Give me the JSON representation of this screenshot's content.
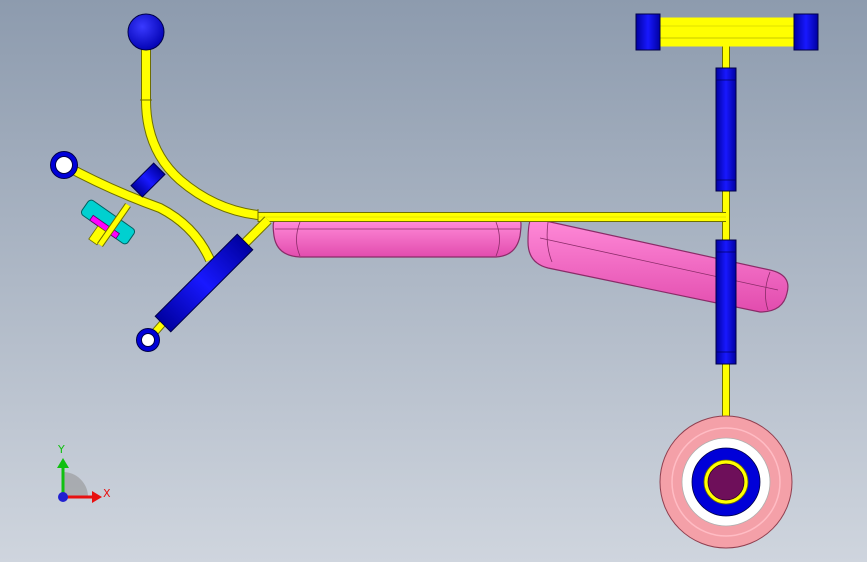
{
  "viewport": {
    "background_top": "#8d9bae",
    "background_bottom": "#cfd5de"
  },
  "colors": {
    "frame": "#ffff00",
    "frame_edge": "#6e6e00",
    "cylinder": "#0000d8",
    "cylinder_edge": "#000048",
    "seat": "#ff66c8",
    "seat_edge": "#8a2c68",
    "disc": "#00d0d0",
    "disc_accent": "#ff00ff",
    "wheel_tire": "#f4a0a8",
    "wheel_rim": "#ffffff",
    "wheel_hub": "#0000d8",
    "wheel_core": "#6e0f5a"
  },
  "model": {
    "parts": [
      {
        "name": "handle-knob",
        "icon": "ball"
      },
      {
        "name": "bent-lever-tube",
        "icon": "tube"
      },
      {
        "name": "main-frame-tube",
        "icon": "tube"
      },
      {
        "name": "link-arm",
        "icon": "tube"
      },
      {
        "name": "damper-cylinder",
        "icon": "cylinder"
      },
      {
        "name": "small-cylinder",
        "icon": "cylinder"
      },
      {
        "name": "rear-disc",
        "icon": "disc"
      },
      {
        "name": "front-seat-pad",
        "icon": "pad"
      },
      {
        "name": "rear-seat-pad",
        "icon": "pad"
      },
      {
        "name": "t-handlebar",
        "icon": "bar"
      },
      {
        "name": "steering-column",
        "icon": "tube"
      },
      {
        "name": "front-wheel",
        "icon": "wheel"
      }
    ]
  },
  "triad": {
    "x_label": "X",
    "y_label": "Y",
    "x_color": "#e81010",
    "y_color": "#10c010",
    "origin_color": "#2020d0"
  }
}
